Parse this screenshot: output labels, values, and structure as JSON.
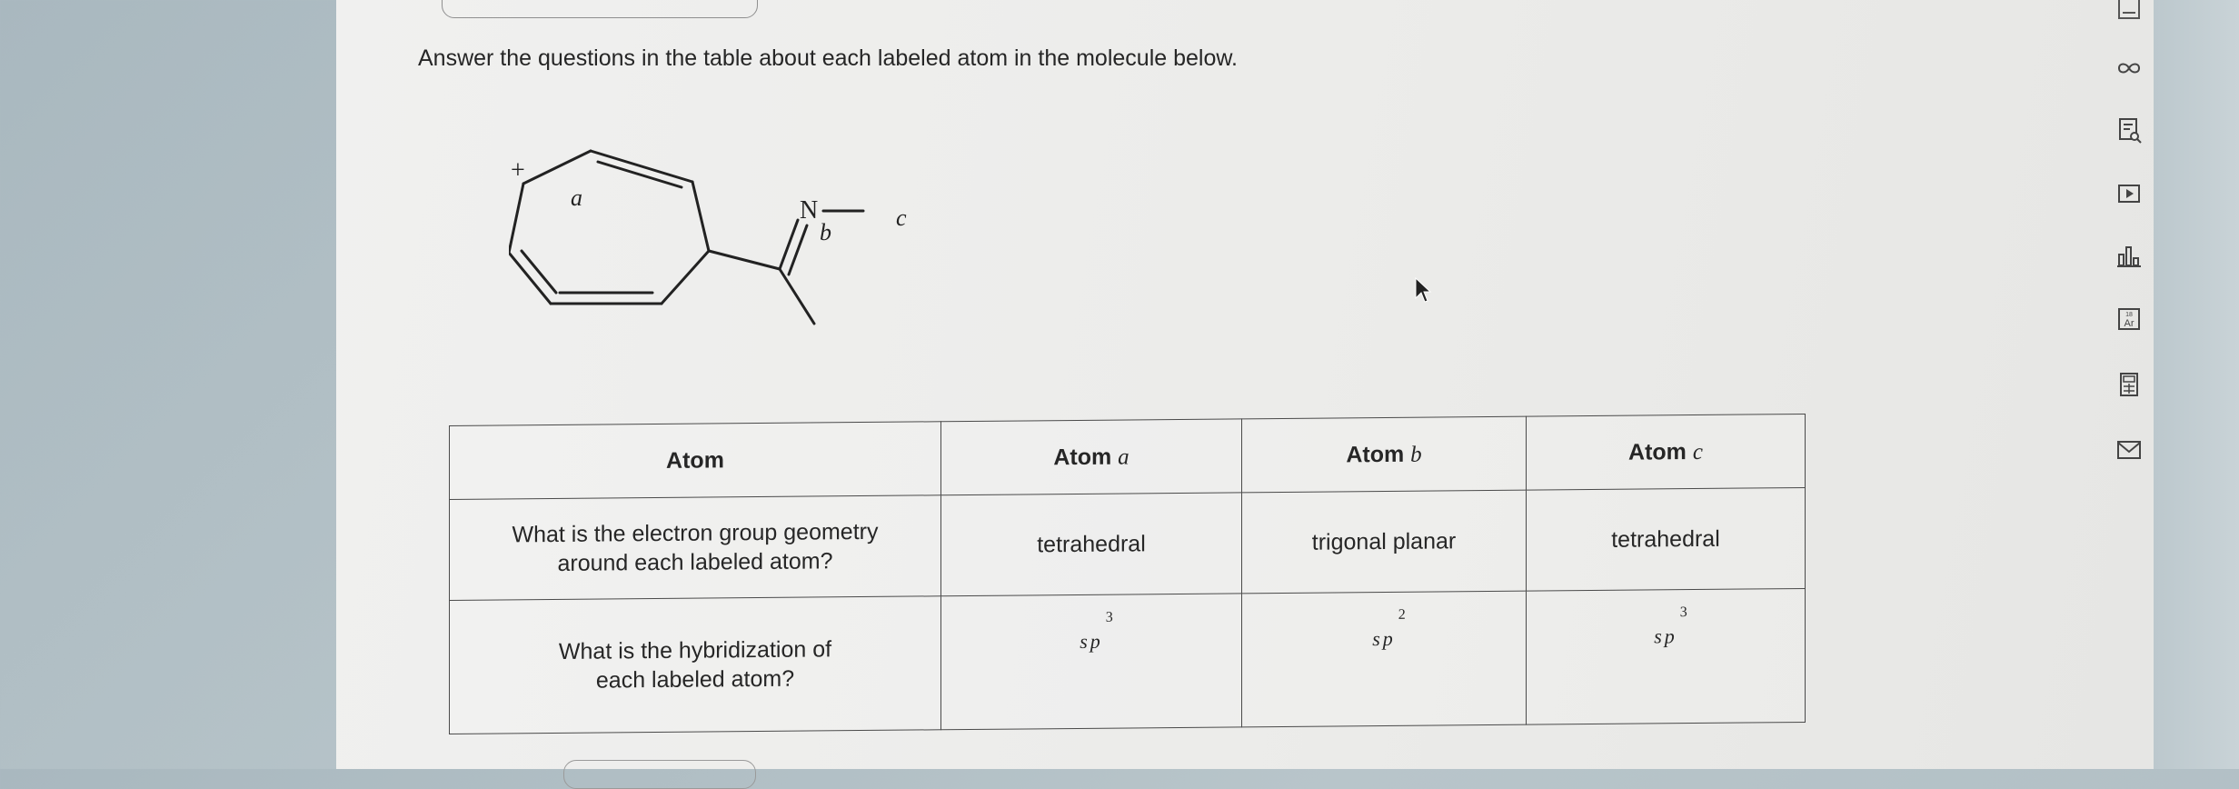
{
  "question": "Answer the questions in the table about each labeled atom in the molecule below.",
  "molecule": {
    "charge": "+",
    "atom_a": "a",
    "atom_b": "b",
    "atom_c": "c",
    "nitrogen": "N"
  },
  "table": {
    "headers": {
      "atom": "Atom",
      "atom_a_prefix": "Atom",
      "atom_a_var": "a",
      "atom_b_prefix": "Atom",
      "atom_b_var": "b",
      "atom_c_prefix": "Atom",
      "atom_c_var": "c"
    },
    "row1": {
      "question": "What is the electron group geometry around each labeled atom?",
      "a": "tetrahedral",
      "b": "trigonal planar",
      "c": "tetrahedral"
    },
    "row2": {
      "question": "What is the hybridization of each labeled atom?",
      "a_base": "sp",
      "a_exp": "3",
      "b_base": "sp",
      "b_exp": "2",
      "c_base": "sp",
      "c_exp": "3"
    }
  },
  "sidebar_icons": [
    "infinity-icon",
    "document-search-icon",
    "play-icon",
    "chart-icon",
    "periodic-table-icon",
    "calculator-icon",
    "mail-icon"
  ],
  "colors": {
    "text": "#262626",
    "border": "#4a4a4a",
    "page": "#eeeeec"
  }
}
